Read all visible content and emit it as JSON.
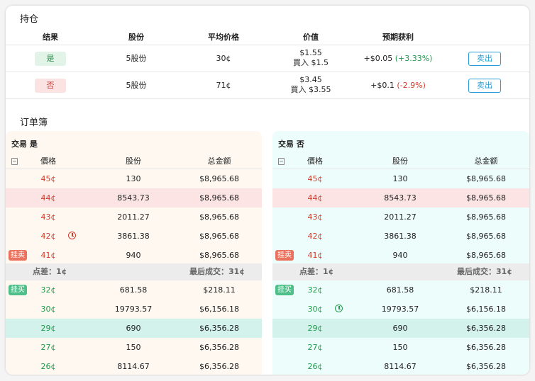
{
  "positions": {
    "title": "持仓",
    "headers": {
      "result": "结果",
      "shares": "股份",
      "avg_price": "平均价格",
      "value": "价值",
      "expected_profit": "预期获利"
    },
    "rows": [
      {
        "result": "是",
        "shares": "5股份",
        "avg_price": "30¢",
        "value": "$1.55",
        "bought": "買入 $1.5",
        "profit": "+$0.05",
        "profit_pct": "(+3.33%)",
        "action": "卖出"
      },
      {
        "result": "否",
        "shares": "5股份",
        "avg_price": "71¢",
        "value": "$3.45",
        "bought": "買入 $3.55",
        "profit": "+$0.1",
        "profit_pct": "(-2.9%)",
        "action": "卖出"
      }
    ]
  },
  "orderbook": {
    "title": "订单簿",
    "headers": {
      "price": "價格",
      "shares": "股份",
      "total": "总金额"
    },
    "books": [
      {
        "title": "交易  是",
        "asks": [
          {
            "price": "45¢",
            "shares": "130",
            "total": "$8,965.68"
          },
          {
            "price": "44¢",
            "shares": "8543.73",
            "total": "$8,965.68"
          },
          {
            "price": "43¢",
            "shares": "2011.27",
            "total": "$8,965.68"
          },
          {
            "price": "42¢",
            "shares": "3861.38",
            "total": "$8,965.68"
          },
          {
            "price": "41¢",
            "shares": "940",
            "total": "$8,965.68"
          }
        ],
        "ask_tag": "挂卖",
        "spread": "点差：1¢",
        "last_trade": "最后成交：31¢",
        "bid_tag": "挂买",
        "bids": [
          {
            "price": "32¢",
            "shares": "681.58",
            "total": "$218.11"
          },
          {
            "price": "30¢",
            "shares": "19793.57",
            "total": "$6,156.18"
          },
          {
            "price": "29¢",
            "shares": "690",
            "total": "$6,356.28"
          },
          {
            "price": "27¢",
            "shares": "150",
            "total": "$6,356.28"
          },
          {
            "price": "26¢",
            "shares": "8114.67",
            "total": "$6,356.28"
          }
        ]
      },
      {
        "title": "交易  否",
        "asks": [
          {
            "price": "45¢",
            "shares": "130",
            "total": "$8,965.68"
          },
          {
            "price": "44¢",
            "shares": "8543.73",
            "total": "$8,965.68"
          },
          {
            "price": "43¢",
            "shares": "2011.27",
            "total": "$8,965.68"
          },
          {
            "price": "42¢",
            "shares": "3861.38",
            "total": "$8,965.68"
          },
          {
            "price": "41¢",
            "shares": "940",
            "total": "$8,965.68"
          }
        ],
        "ask_tag": "挂卖",
        "spread": "点差：1¢",
        "last_trade": "最后成交：31¢",
        "bid_tag": "挂买",
        "bids": [
          {
            "price": "32¢",
            "shares": "681.58",
            "total": "$218.11"
          },
          {
            "price": "30¢",
            "shares": "19793.57",
            "total": "$6,156.18"
          },
          {
            "price": "29¢",
            "shares": "690",
            "total": "$6,356.28"
          },
          {
            "price": "27¢",
            "shares": "150",
            "total": "$6,356.28"
          },
          {
            "price": "26¢",
            "shares": "8114.67",
            "total": "$6,356.28"
          }
        ]
      }
    ]
  },
  "colors": {
    "yes_green": "#1e9a4a",
    "no_red": "#d03a2a",
    "sell_button": "#2a9fd6",
    "ask_tag": "#e9735e",
    "bid_tag": "#4fbf8a"
  },
  "icons": {
    "sort": "sort-icon",
    "pending_order": "clock-icon"
  }
}
